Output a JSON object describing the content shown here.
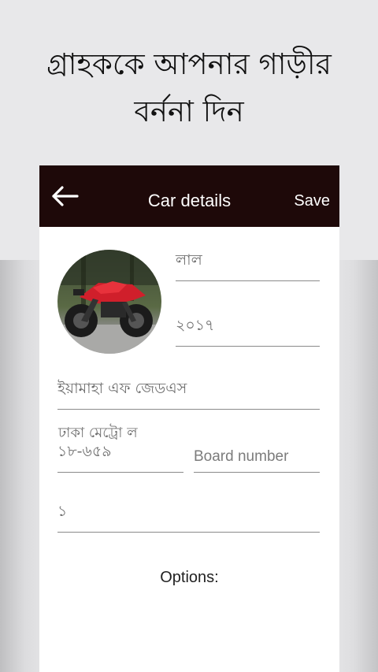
{
  "promo": {
    "headline_line1": "গ্রাহককে আপনার গাড়ীর",
    "headline_line2": "বর্ননা দিন"
  },
  "appbar": {
    "title": "Car details",
    "save_label": "Save",
    "back_icon": "arrow-left-icon",
    "background": "#1e0909"
  },
  "form": {
    "color_value": "লাল",
    "year_value": "২০১৭",
    "model_value": "ইয়ামাহা এফ জেডএস",
    "area_label": "ঢাকা মেট্রো ল",
    "plate_value": "১৮-৬৫৯",
    "board_placeholder": "Board number",
    "count_value": "১",
    "options_label": "Options:"
  }
}
